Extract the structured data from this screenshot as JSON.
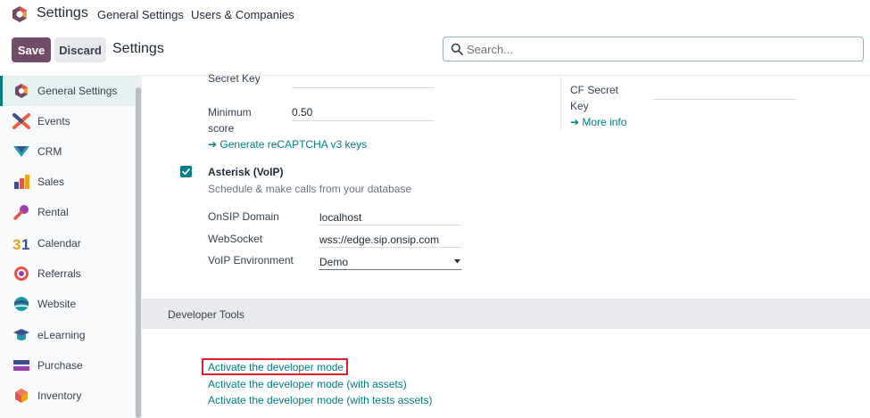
{
  "navbar": {
    "app_name": "Settings",
    "menus": [
      "General Settings",
      "Users & Companies"
    ]
  },
  "control_panel": {
    "save_label": "Save",
    "discard_label": "Discard",
    "title": "Settings",
    "search_placeholder": "Search..."
  },
  "sidebar": {
    "items": [
      {
        "label": "General Settings",
        "icon": "odoo-logo-icon",
        "color": "#e0564b"
      },
      {
        "label": "Events",
        "icon": "events-icon",
        "color": "#f06040"
      },
      {
        "label": "CRM",
        "icon": "crm-icon",
        "color": "#1f9aa6"
      },
      {
        "label": "Sales",
        "icon": "sales-icon",
        "color": "#e8a318"
      },
      {
        "label": "Rental",
        "icon": "rental-icon",
        "color": "#9b3fb0"
      },
      {
        "label": "Calendar",
        "icon": "calendar-icon",
        "color": "#e8a318"
      },
      {
        "label": "Referrals",
        "icon": "referrals-icon",
        "color": "#e0564b"
      },
      {
        "label": "Website",
        "icon": "website-icon",
        "color": "#1f9aa6"
      },
      {
        "label": "eLearning",
        "icon": "elearning-icon",
        "color": "#1f9aa6"
      },
      {
        "label": "Purchase",
        "icon": "purchase-icon",
        "color": "#3b4f8f"
      },
      {
        "label": "Inventory",
        "icon": "inventory-icon",
        "color": "#e0564b"
      }
    ]
  },
  "recaptcha": {
    "secret_key_label": "Secret Key",
    "min_score_label_1": "Minimum",
    "min_score_label_2": "score",
    "min_score_value": "0.50",
    "generate_link": "Generate reCAPTCHA v3 keys"
  },
  "cloudflare": {
    "secret_label_1": "CF Secret",
    "secret_label_2": "Key",
    "more_info_link": "More info"
  },
  "voip": {
    "title": "Asterisk (VoIP)",
    "checked": true,
    "description": "Schedule & make calls from your database",
    "onsip_domain_label": "OnSIP Domain",
    "onsip_domain_value": "localhost",
    "websocket_label": "WebSocket",
    "websocket_value": "wss://edge.sip.onsip.com",
    "environment_label": "VoIP Environment",
    "environment_value": "Demo"
  },
  "developer_tools": {
    "title": "Developer Tools",
    "links": [
      "Activate the developer mode",
      "Activate the developer mode (with assets)",
      "Activate the developer mode (with tests assets)"
    ]
  },
  "colors": {
    "brand": "#714b67",
    "accent": "#017e84",
    "highlight": "#e11d2a"
  }
}
